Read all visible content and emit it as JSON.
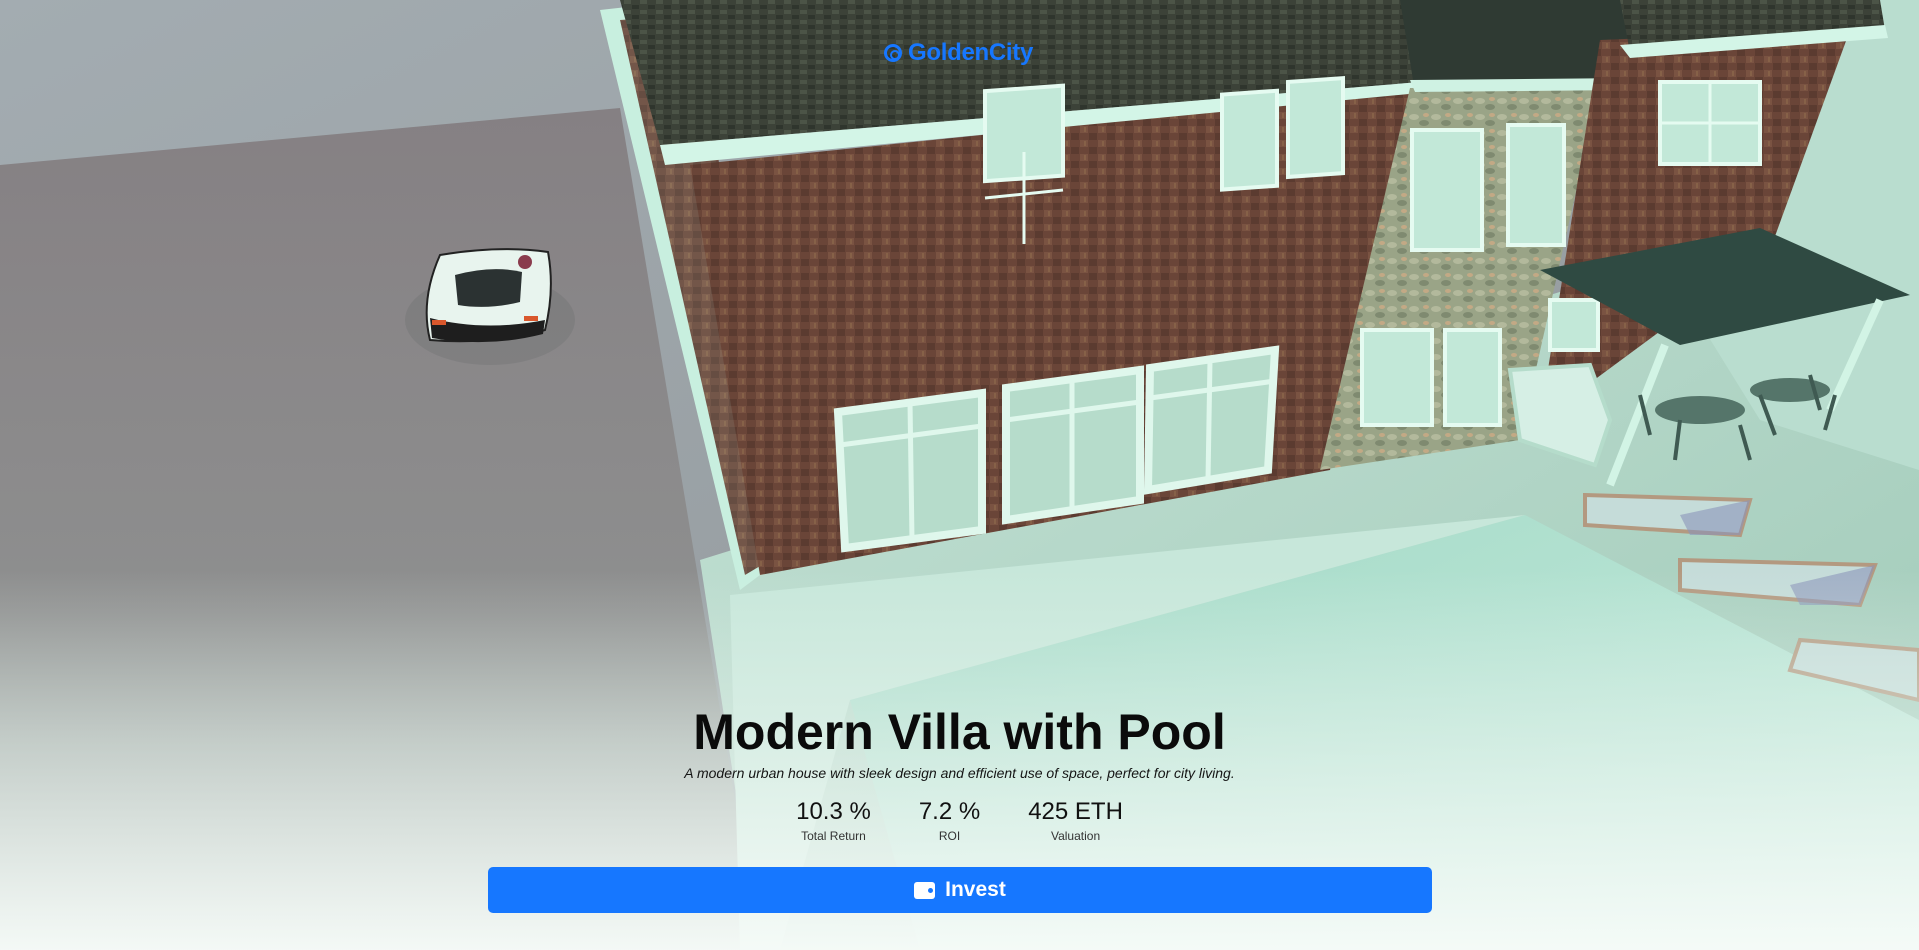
{
  "brand": {
    "name": "GoldenCity",
    "color": "#1677ff"
  },
  "property": {
    "title": "Modern Villa with Pool",
    "description": "A modern urban house with sleek design and efficient use of space, perfect for city living."
  },
  "stats": [
    {
      "value": "10.3 %",
      "label": "Total Return"
    },
    {
      "value": "7.2 %",
      "label": "ROI"
    },
    {
      "value": "425 ETH",
      "label": "Valuation"
    }
  ],
  "cta": {
    "label": "Invest",
    "icon": "wallet-icon",
    "color": "#1677ff"
  },
  "scene": {
    "description_icons": [
      "house-3d-model",
      "car-3d-model",
      "pool",
      "patio-furniture"
    ]
  }
}
